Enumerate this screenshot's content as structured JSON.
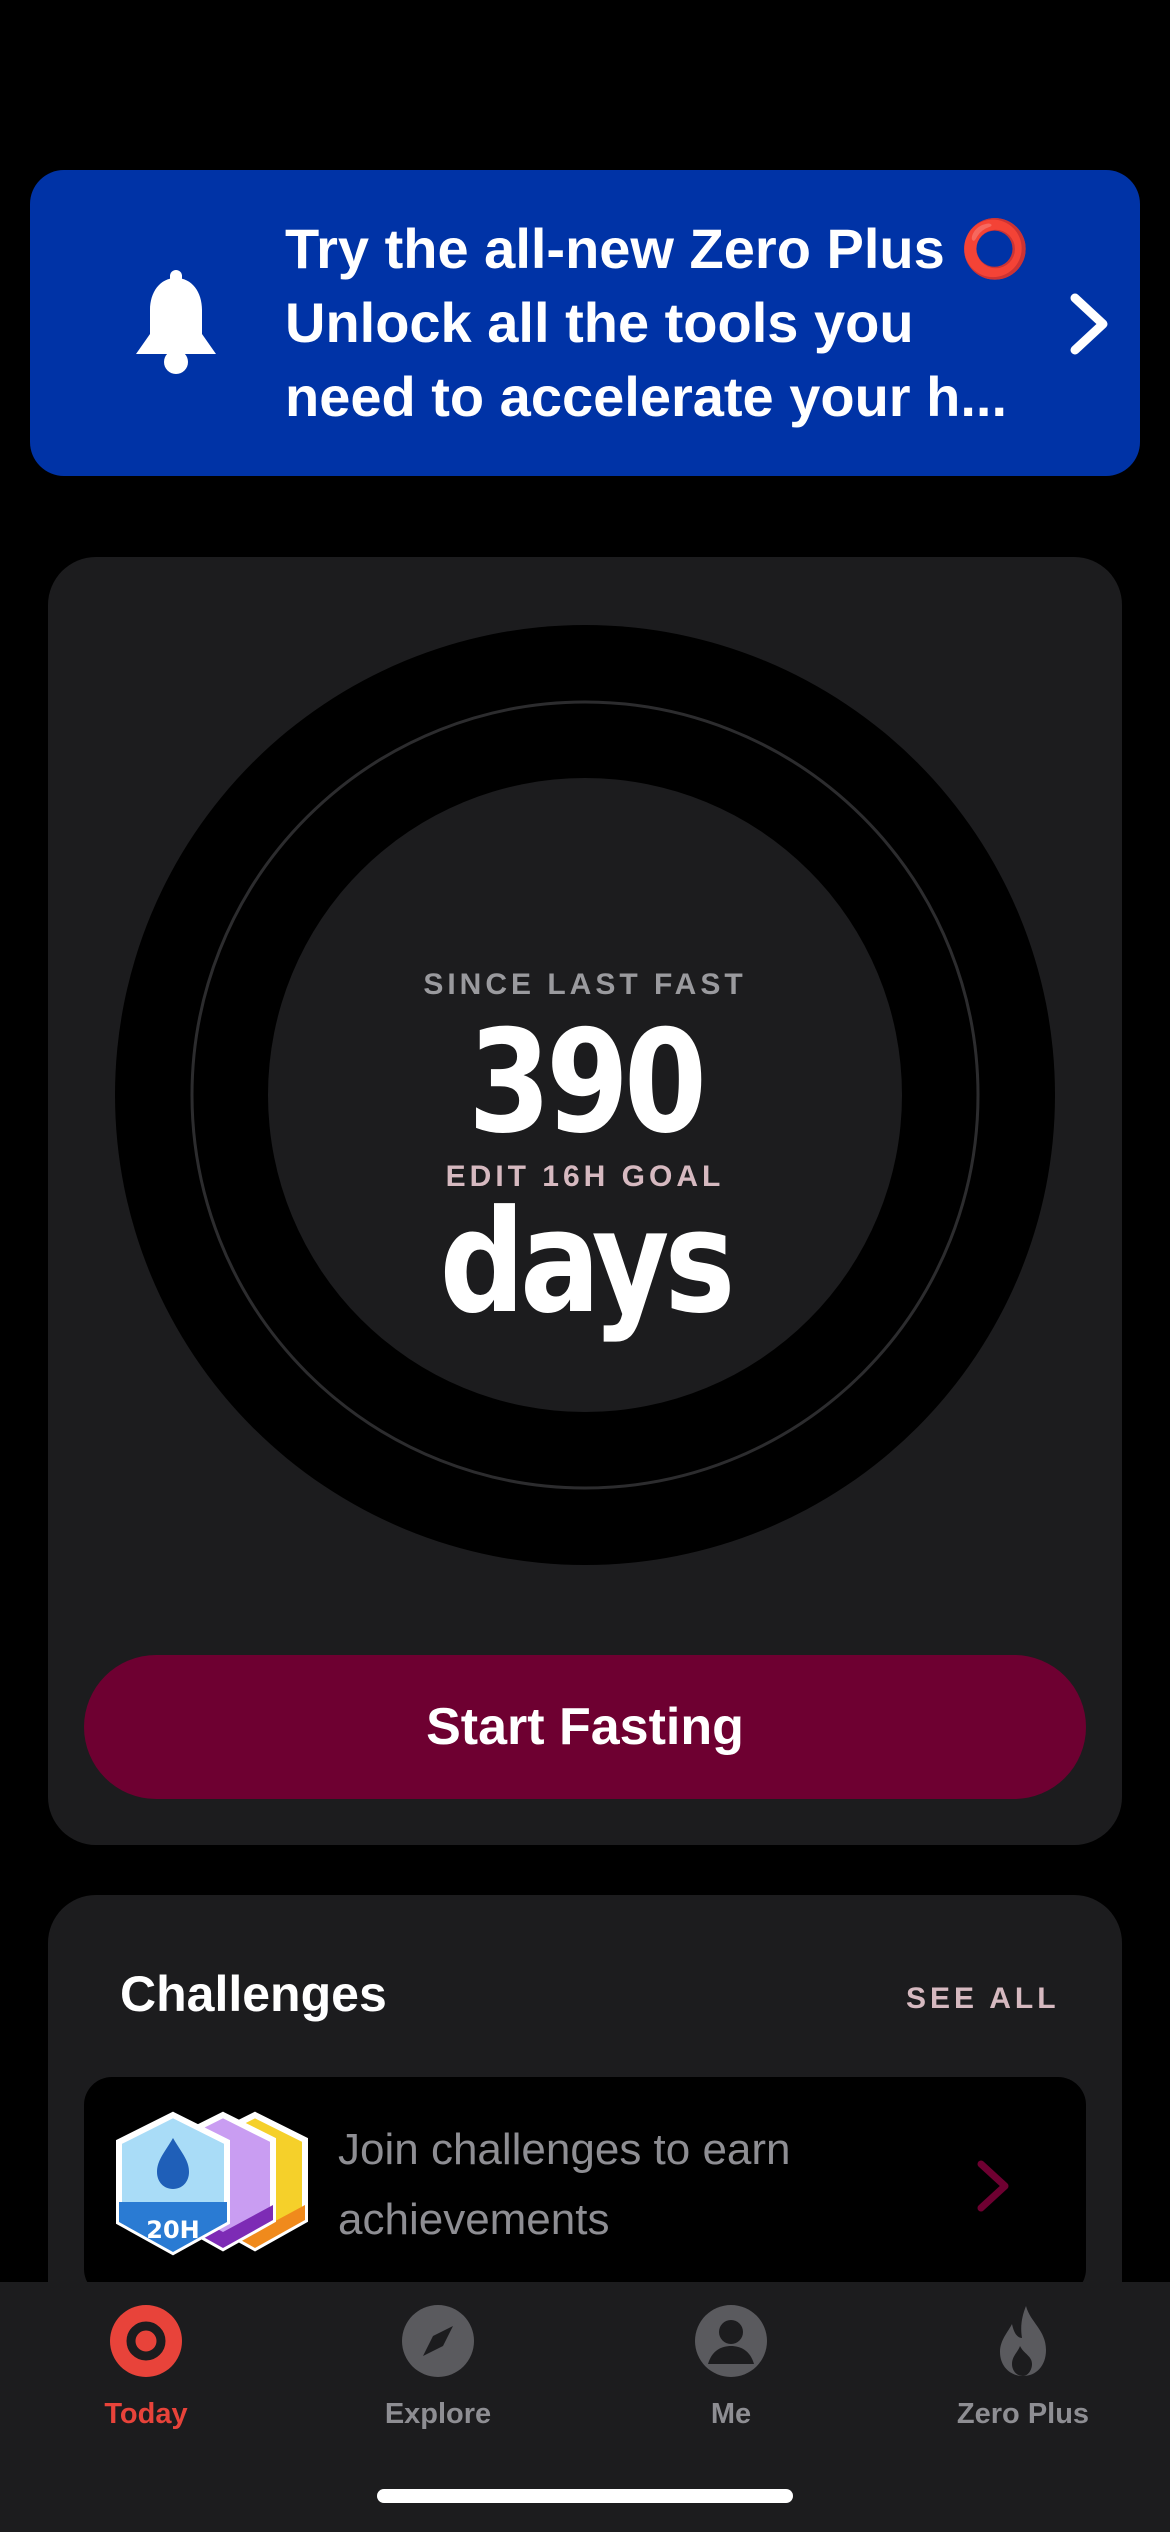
{
  "banner": {
    "line1": "Try the all-new Zero Plus ⭕",
    "line2": "Unlock all the tools you",
    "line3": "need to accelerate your h..."
  },
  "timer": {
    "since_label": "SINCE LAST FAST",
    "value": "390 days",
    "edit_goal": "EDIT 16H GOAL"
  },
  "start_button": "Start Fasting",
  "challenges": {
    "title": "Challenges",
    "see_all": "SEE ALL",
    "badge_label": "20H",
    "prompt": "Join challenges to earn achievements"
  },
  "tabs": [
    {
      "label": "Today",
      "icon": "today-ring-icon",
      "active": true
    },
    {
      "label": "Explore",
      "icon": "compass-icon",
      "active": false
    },
    {
      "label": "Me",
      "icon": "person-icon",
      "active": false
    },
    {
      "label": "Zero Plus",
      "icon": "flame-icon",
      "active": false
    }
  ],
  "colors": {
    "banner_bg": "#0033a6",
    "card_bg": "#1c1c1e",
    "start_button_bg": "#6e0031",
    "accent_red": "#e8433a",
    "muted_pink": "#d6b9c0"
  }
}
